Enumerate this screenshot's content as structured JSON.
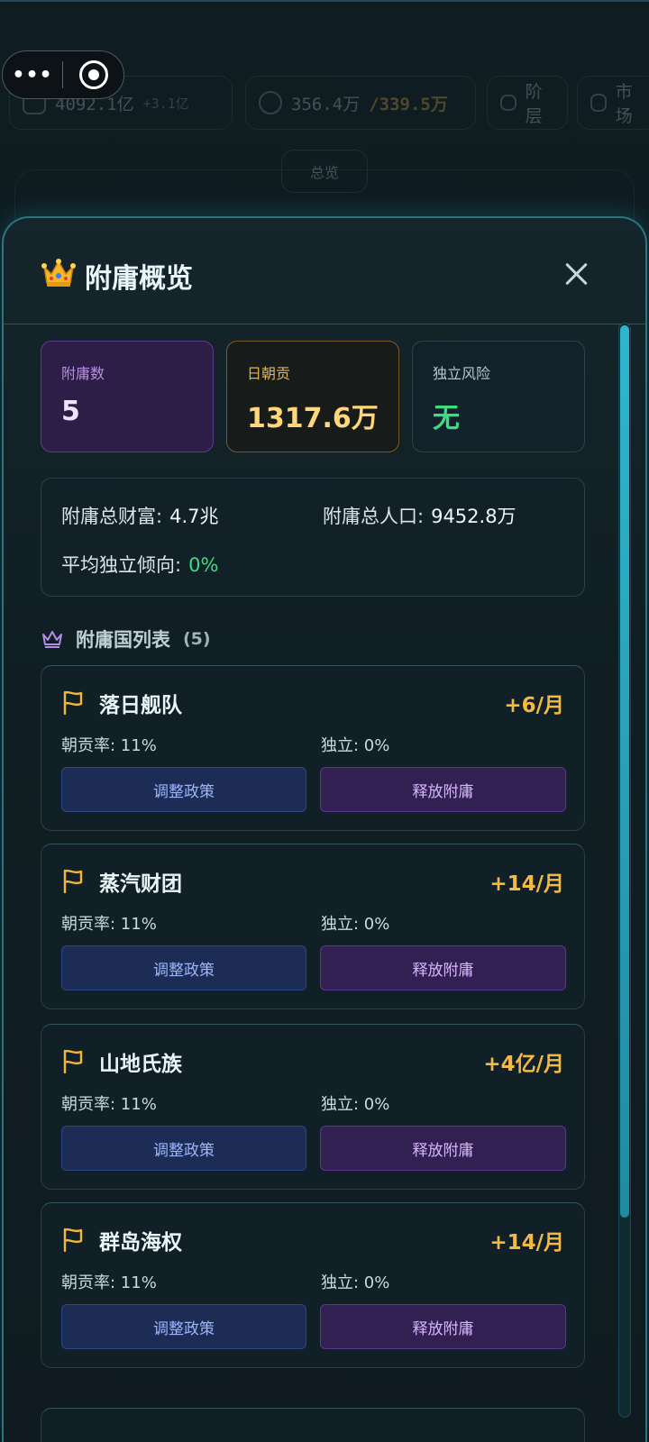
{
  "background": {
    "stats": [
      {
        "value": "4092.1亿",
        "delta": "+3.1亿"
      },
      {
        "value": "356.4万",
        "extra": "/339.5万"
      },
      {
        "label": "阶层"
      },
      {
        "label": "市场"
      }
    ],
    "overview_tab": "总览"
  },
  "capsule": {
    "more": "•••"
  },
  "modal": {
    "title": "附庸概览",
    "title_icon": "crown-emoji-icon",
    "stats": [
      {
        "label": "附庸数",
        "value": "5"
      },
      {
        "label": "日朝贡",
        "value": "1317.6万"
      },
      {
        "label": "独立风险",
        "value": "无"
      }
    ],
    "summary": {
      "total_wealth_label": "附庸总财富:",
      "total_wealth": "4.7兆",
      "total_population_label": "附庸总人口:",
      "total_population": "9452.8万",
      "avg_independence_label": "平均独立倾向:",
      "avg_independence": "0%"
    },
    "list": {
      "title": "附庸国列表",
      "count": "(5)",
      "items": [
        {
          "name": "落日舰队",
          "tribute": "+6/月",
          "rate": "朝贡率: 11%",
          "independence": "独立: 0%",
          "adjust_label": "调整政策",
          "release_label": "释放附庸"
        },
        {
          "name": "蒸汽财团",
          "tribute": "+14/月",
          "rate": "朝贡率: 11%",
          "independence": "独立: 0%",
          "adjust_label": "调整政策",
          "release_label": "释放附庸"
        },
        {
          "name": "山地氏族",
          "tribute": "+4亿/月",
          "rate": "朝贡率: 11%",
          "independence": "独立: 0%",
          "adjust_label": "调整政策",
          "release_label": "释放附庸"
        },
        {
          "name": "群岛海权",
          "tribute": "+14/月",
          "rate": "朝贡率: 11%",
          "independence": "独立: 0%",
          "adjust_label": "调整政策",
          "release_label": "释放附庸"
        }
      ]
    }
  },
  "colors": {
    "accent": "#2fb6cf",
    "tribute_gold": "#f5b942",
    "risk_green": "#3ddc84",
    "vassal_purple": "#5c3b92"
  }
}
